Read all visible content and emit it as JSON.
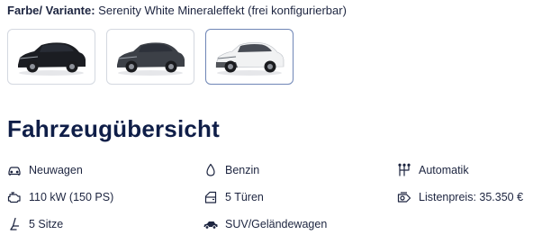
{
  "variant": {
    "label": "Farbe/ Variante:",
    "value": "Serenity White Mineraleffekt (frei konfigurierbar)"
  },
  "swatches": [
    {
      "color_name": "black",
      "body": "#1b1d22",
      "selected": false
    },
    {
      "color_name": "dark-grey",
      "body": "#3c4047",
      "selected": false
    },
    {
      "color_name": "serenity-white",
      "body": "#f1f2f3",
      "selected": true
    }
  ],
  "overview": {
    "title": "Fahrzeugübersicht",
    "specs": [
      {
        "icon": "car-icon",
        "text": "Neuwagen"
      },
      {
        "icon": "fuel-drop-icon",
        "text": "Benzin"
      },
      {
        "icon": "gearshift-icon",
        "text": "Automatik"
      },
      {
        "icon": "engine-icon",
        "text": "110 kW (150 PS)"
      },
      {
        "icon": "door-icon",
        "text": "5 Türen"
      },
      {
        "icon": "price-tag-icon",
        "text": "Listenpreis: 35.350 €"
      },
      {
        "icon": "seat-icon",
        "text": "5 Sitze"
      },
      {
        "icon": "suv-icon",
        "text": "SUV/Geländewagen"
      }
    ]
  },
  "colors": {
    "heading": "#0f1e48",
    "text": "#1d2540",
    "selected_border": "#6f86b6",
    "swatch_border": "#d4d8e0"
  }
}
